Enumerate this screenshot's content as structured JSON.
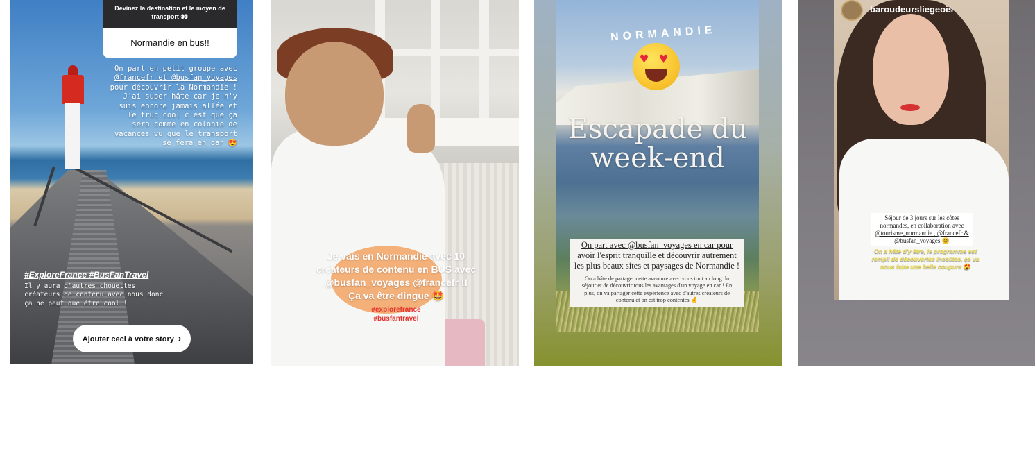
{
  "stories": [
    {
      "question_prompt": "Devinez la destination et le moyen de transport 👀",
      "question_answer": "Normandie en bus!!",
      "text_lines": [
        "On part en petit groupe avec",
        "@francefr et @busfan_voyages",
        "pour découvrir la Normandie !",
        "J'ai super hâte car je n'y",
        "suis encore jamais allée et",
        "le truc cool c'est que ça",
        "sera comme en colonie de",
        "vacances vu que le transport",
        "se fera en car 😍"
      ],
      "hashtags": "#ExploreFrance #BusFanTravel",
      "secondary_lines": [
        "Il y aura d'autres chouettes",
        "créateurs de contenu avec nous donc",
        "ça ne peut que être cool !"
      ],
      "add_button_label": "Ajouter ceci à votre story",
      "add_button_icon": "chevron-right-icon"
    },
    {
      "caption_lines": [
        "Je vais en Normandie avec 10",
        "créateurs de contenu en BUS avec",
        "@busfan_voyages @francefr !!",
        "Ça va être dingue 🤩"
      ],
      "hashtag_1": "#explorefrance",
      "hashtag_2": "#busfantravel"
    },
    {
      "sticker_text": "NORMANDIE",
      "emoji_icon": "heart-eyes-emoji-icon",
      "title_lines": [
        "Escapade du",
        "week-end"
      ],
      "box1_lines": [
        "On part avec @busfan_voyages en car pour",
        "avoir l'esprit tranquille et découvrir autrement",
        "les plus beaux sites et paysages de Normandie !"
      ],
      "box2_lines": [
        "On a hâte de partager cette aventure avec vous tout au long du",
        "séjour et de découvrir tous les avantages d'un voyage en car ! En",
        "plus, on va partager cette expérience avec d'autres créateurs de",
        "contenu et on est trop contentes 🤞"
      ]
    },
    {
      "username": "baroudeursliegeois",
      "box_lines": [
        "Séjour de 3 jours sur les côtes",
        "normandes, en collaboration avec",
        "@tourisme_normandie , @francefr &",
        "@busfan_voyages 😊"
      ],
      "yellow_lines": [
        "On a hâte d'y être, le programme est",
        "rempli de découvertes insolites, ça va",
        "nous faire une belle coupure 😍"
      ]
    }
  ],
  "colors": {
    "page_background": "#ffffff",
    "hashtag_red": "#e3342f",
    "caption_yellow": "#f2e25a"
  }
}
